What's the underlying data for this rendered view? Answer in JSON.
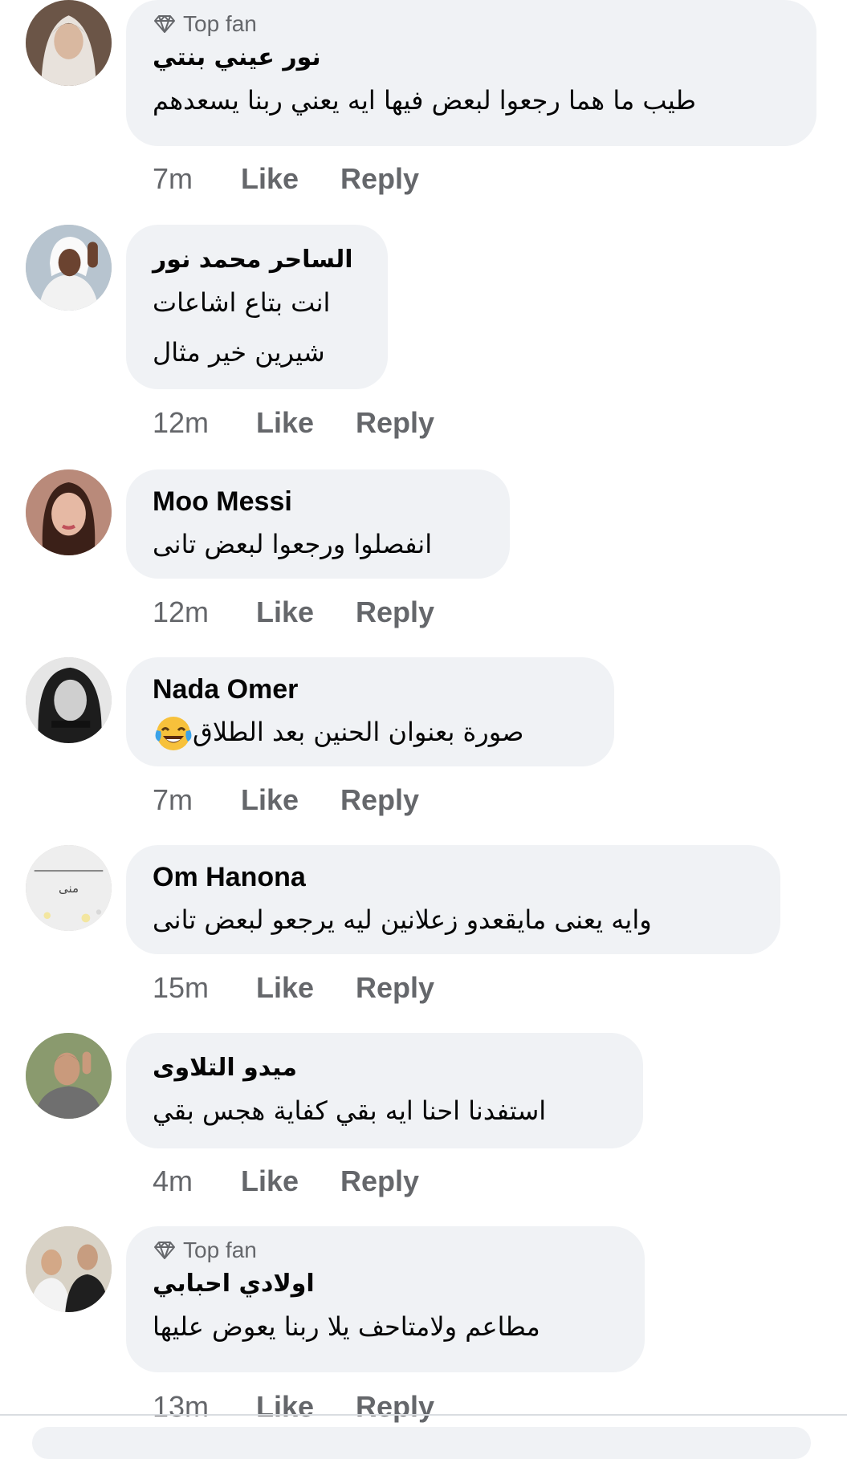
{
  "actions": {
    "like": "Like",
    "reply": "Reply"
  },
  "badge_label": "Top fan",
  "comments": [
    {
      "name": "نور عيني بنتي",
      "top_fan": true,
      "lines": [
        "طيب ما هما رجعوا لبعض فيها ايه يعني ربنا يسعدهم"
      ],
      "time": "7m"
    },
    {
      "name": "الساحر محمد نور",
      "top_fan": false,
      "lines": [
        "انت بتاع اشاعات",
        "شيرين خير مثال"
      ],
      "time": "12m"
    },
    {
      "name": "Moo Messi",
      "top_fan": false,
      "lines": [
        "انفصلوا ورجعوا لبعض تانى"
      ],
      "time": "12m"
    },
    {
      "name": "Nada Omer",
      "top_fan": false,
      "lines": [
        "صورة بعنوان الحنين بعد الطلاق"
      ],
      "time": "7m",
      "emoji": "face-with-tears-of-joy"
    },
    {
      "name": "Om Hanona",
      "top_fan": false,
      "lines": [
        "وايه يعنى مايقعدو زعلانين ليه يرجعو لبعض تانى"
      ],
      "time": "15m",
      "avatar_text": "منى"
    },
    {
      "name": "ميدو التلاوى",
      "top_fan": false,
      "lines": [
        "استفدنا احنا ايه بقي كفاية هجس بقي"
      ],
      "time": "4m"
    },
    {
      "name": "اولادي احبابي",
      "top_fan": true,
      "lines": [
        "مطاعم ولامتاحف يلا ربنا يعوض عليها"
      ],
      "time": "13m"
    }
  ],
  "colors": {
    "bubble": "#f0f2f5",
    "meta": "#65676b",
    "text": "#050505"
  }
}
